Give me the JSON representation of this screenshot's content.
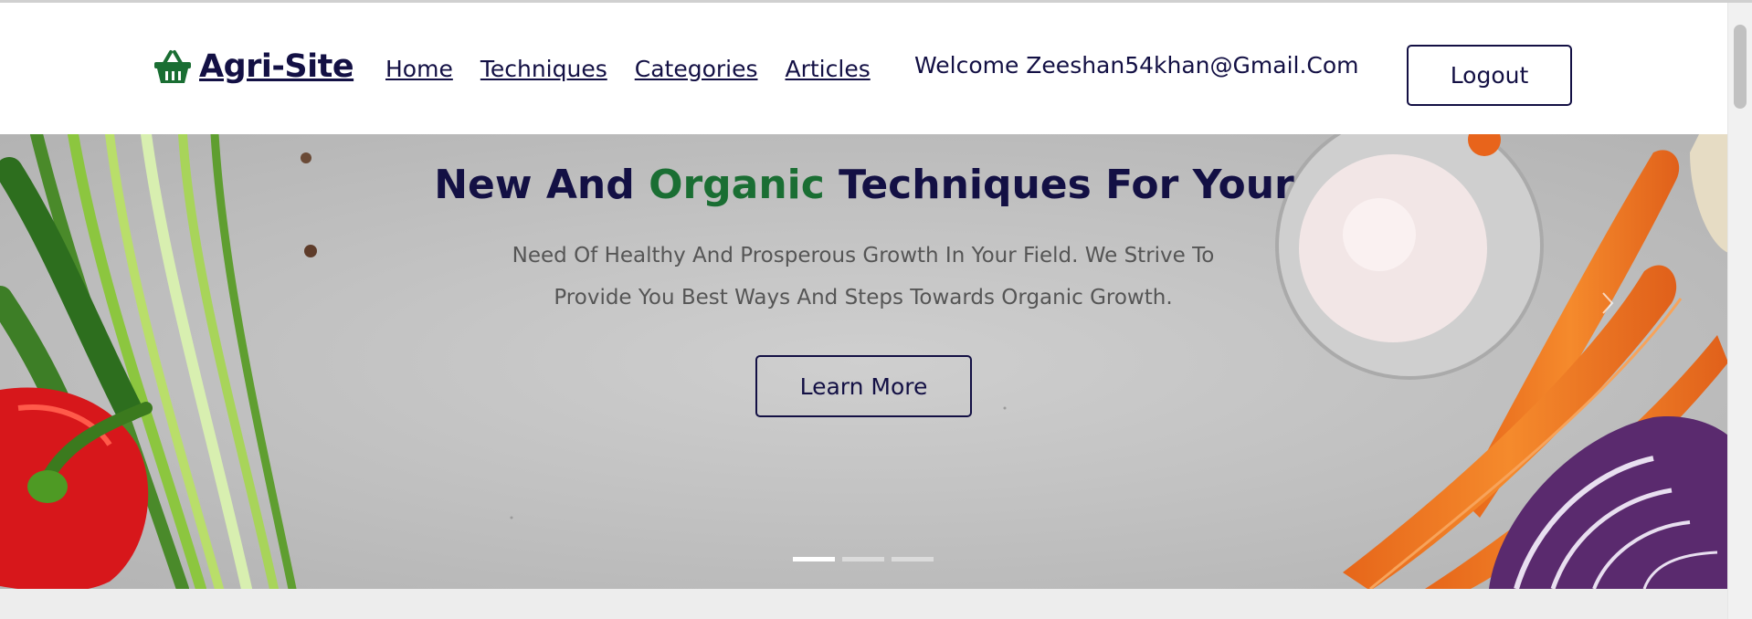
{
  "brand": {
    "name": "Agri-Site",
    "icon": "shopping-basket-icon",
    "color": "#1a6e33"
  },
  "nav": {
    "items": [
      "Home",
      "Techniques",
      "Categories",
      "Articles"
    ]
  },
  "user": {
    "welcome_text": "Welcome Zeeshan54khan@Gmail.Com",
    "logout_label": "Logout"
  },
  "hero": {
    "title_part1": "New And ",
    "title_accent": "Organic",
    "title_part2": " Techniques For Your",
    "line1": "Need Of Healthy And Prosperous Growth In Your Field. We Strive To",
    "line2": "Provide You Best Ways And Steps Towards Organic Growth.",
    "button_label": "Learn More",
    "slides": 3,
    "active_slide": 1
  },
  "colors": {
    "primary": "#131044",
    "accent": "#1a6e33",
    "body_text": "#555555"
  }
}
